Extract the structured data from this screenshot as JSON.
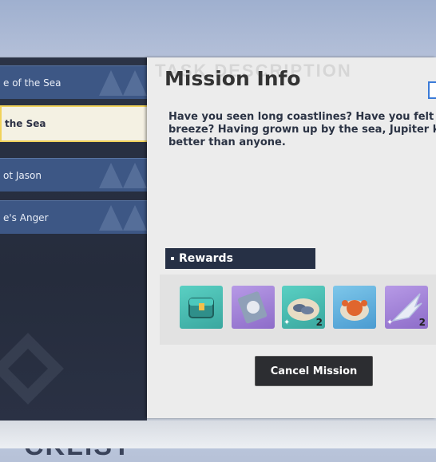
{
  "quest_list": {
    "items": [
      {
        "label": "e of the Sea",
        "state": "normal"
      },
      {
        "label": "the Sea",
        "state": "selected"
      },
      {
        "label": "ot Jason",
        "state": "normal"
      },
      {
        "label": "e's Anger",
        "state": "normal"
      }
    ],
    "watermark_text": "CKLIST"
  },
  "panel": {
    "background_header": "TASK DESCRIPTION",
    "title": "Mission Info",
    "description": "Have you seen long coastlines? Have you felt t\nbreeze? Having grown up by the sea, Jupiter kr\nbetter than anyone.",
    "rewards_label": "Rewards",
    "rewards": [
      {
        "icon": "treasure-chest-icon",
        "rarity_color": "#4bbfb2",
        "count": ""
      },
      {
        "icon": "scroll-blueprint-icon",
        "rarity_color": "#a587da",
        "count": ""
      },
      {
        "icon": "seafood-plate-icon",
        "rarity_color": "#4bbfb2",
        "count": "2"
      },
      {
        "icon": "crab-dish-icon",
        "rarity_color": "#66b3e0",
        "count": ""
      },
      {
        "icon": "crystal-feather-icon",
        "rarity_color": "#a587da",
        "count": "2"
      }
    ],
    "cancel_button": "Cancel Mission"
  },
  "colors": {
    "quest_item_bg": "#3d5785",
    "selected_border": "#f1d25a",
    "panel_bg": "#ececec",
    "rewards_bar_bg": "#263045"
  }
}
